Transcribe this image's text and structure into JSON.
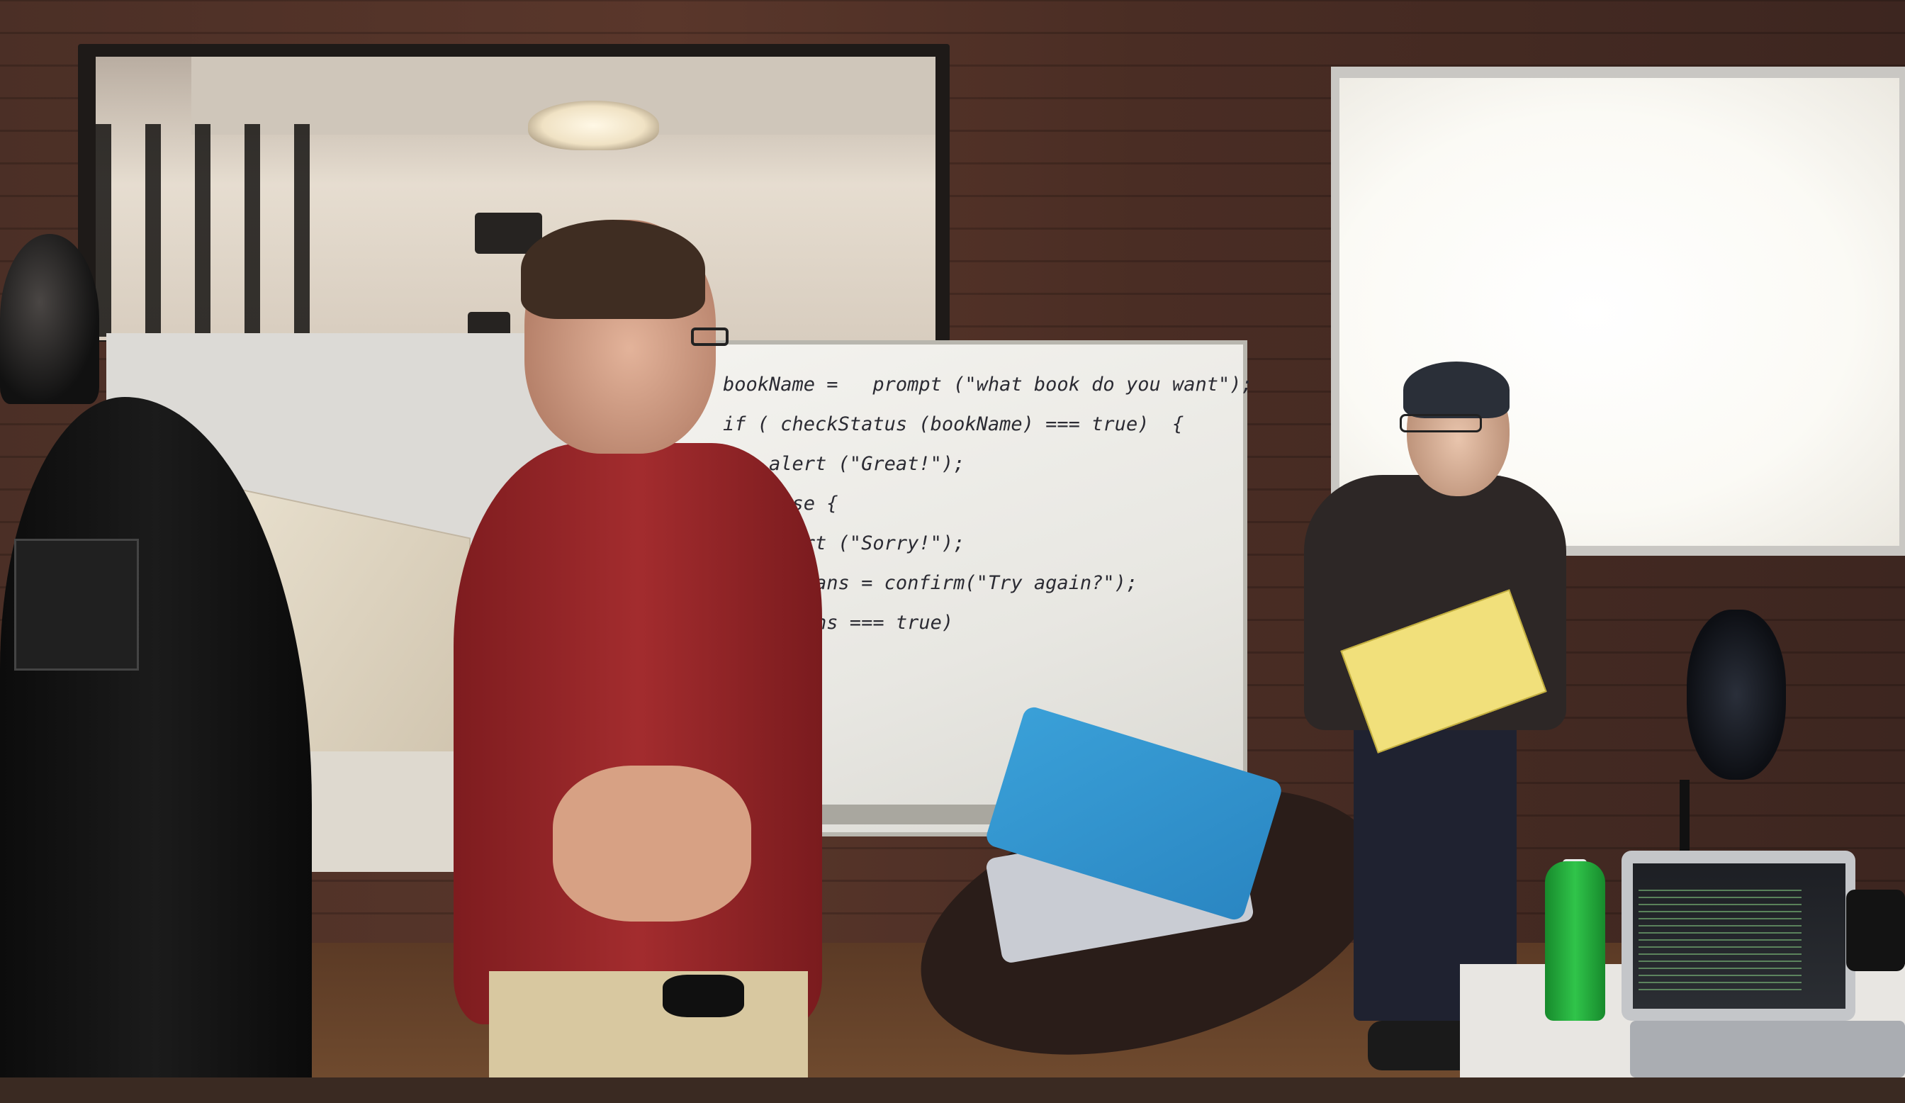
{
  "whiteboard": {
    "code_lines": [
      "bookName =   prompt (\"what book do you want\");",
      "if ( checkStatus (bookName) === true)  {",
      "    alert (\"Great!\");",
      "  } else {",
      "    alert (\"Sorry!\");",
      "    var ans = confirm(\"Try again?\");",
      "    if(ans === true)"
    ]
  },
  "colors": {
    "shirt": "#a32c2e",
    "folder": "#f1e07b",
    "laptop_lid": "#3aa0d8",
    "bottle": "#30c44a"
  }
}
